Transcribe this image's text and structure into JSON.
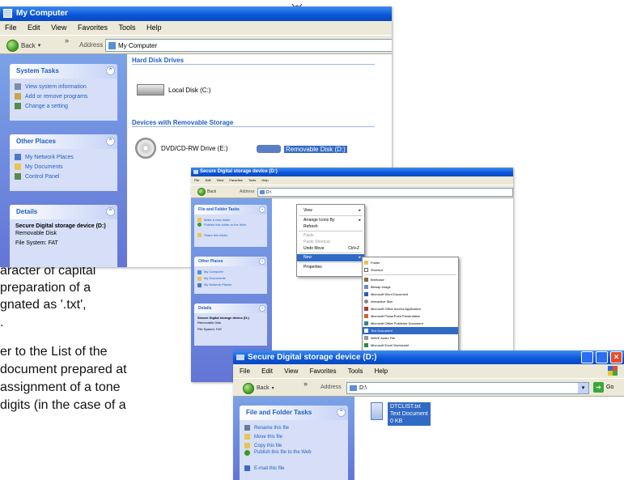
{
  "top_icon": "network-icon",
  "window1": {
    "title": "My Computer",
    "menu": [
      "File",
      "Edit",
      "View",
      "Favorites",
      "Tools",
      "Help"
    ],
    "back_label": "Back",
    "address_label": "Address",
    "address_value": "My Computer",
    "panels": {
      "system_tasks": {
        "title": "System Tasks",
        "items": [
          "View system information",
          "Add or remove programs",
          "Change a setting"
        ]
      },
      "other_places": {
        "title": "Other Places",
        "items": [
          "My Network Places",
          "My Documents",
          "Control Panel"
        ]
      },
      "details": {
        "title": "Details",
        "name": "Secure Digital storage device (D:)",
        "type": "Removable Disk",
        "fs": "File System: FAT"
      }
    },
    "groups": {
      "hdd": "Hard Disk Drives",
      "removable": "Devices with Removable Storage"
    },
    "drives": {
      "local": "Local Disk (C:)",
      "dvd": "DVD/CD-RW Drive (E:)",
      "removable": "Removable Disk (D:)"
    }
  },
  "window2": {
    "title": "Secure Digital storage device (D:)",
    "menu": [
      "File",
      "Edit",
      "View",
      "Favorites",
      "Tools",
      "Help"
    ],
    "back_label": "Back",
    "address_label": "Address",
    "address_value": "D:\\",
    "panels": {
      "file_folder_tasks": {
        "title": "File and Folder Tasks",
        "items": [
          "Make a new folder",
          "Publish this folder to the Web",
          "Share this folder"
        ]
      },
      "other_places": {
        "title": "Other Places",
        "items": [
          "My Computer",
          "My Documents",
          "My Network Places"
        ]
      },
      "details": {
        "title": "Details",
        "name": "Secure Digital storage device (D:)",
        "type": "Removable Disk",
        "fs": "File System: FAT"
      }
    },
    "context_menu": {
      "view": "View",
      "arrange": "Arrange Icons By",
      "refresh": "Refresh",
      "paste": "Paste",
      "paste_shortcut": "Paste Shortcut",
      "undo": "Undo Move",
      "undo_key": "Ctrl+Z",
      "new": "New",
      "properties": "Properties"
    },
    "new_submenu": [
      "Folder",
      "Shortcut",
      "Briefcase",
      "Bitmap Image",
      "Microsoft Word Document",
      "Interactive Skin",
      "Microsoft Office Access Application",
      "Microsoft PowerPoint Presentation",
      "Microsoft Office Publisher Document",
      "Text Document",
      "WAVE Audio File",
      "Microsoft Excel Worksheet"
    ]
  },
  "window3": {
    "title": "Secure Digital storage device (D:)",
    "menu": [
      "File",
      "Edit",
      "View",
      "Favorites",
      "Tools",
      "Help"
    ],
    "back_label": "Back",
    "address_label": "Address",
    "address_value": "D:\\",
    "go_label": "Go",
    "panel": {
      "title": "File and Folder Tasks",
      "items": [
        "Rename this file",
        "Move this file",
        "Copy this file",
        "Publish this file to the Web",
        "E-mail this file"
      ]
    },
    "file": {
      "name": "DTCLIST.txt",
      "type": "Text Document",
      "size": "0 KB"
    }
  },
  "background_text": {
    "line1": "aracter of capital",
    "line2": "preparation of a",
    "line3": "gnated as '.txt',",
    "line4": ".",
    "line5": "er to the List of the",
    "line6": "document prepared at",
    "line7": "assignment of a tone",
    "line8": "digits (in the case of a"
  }
}
